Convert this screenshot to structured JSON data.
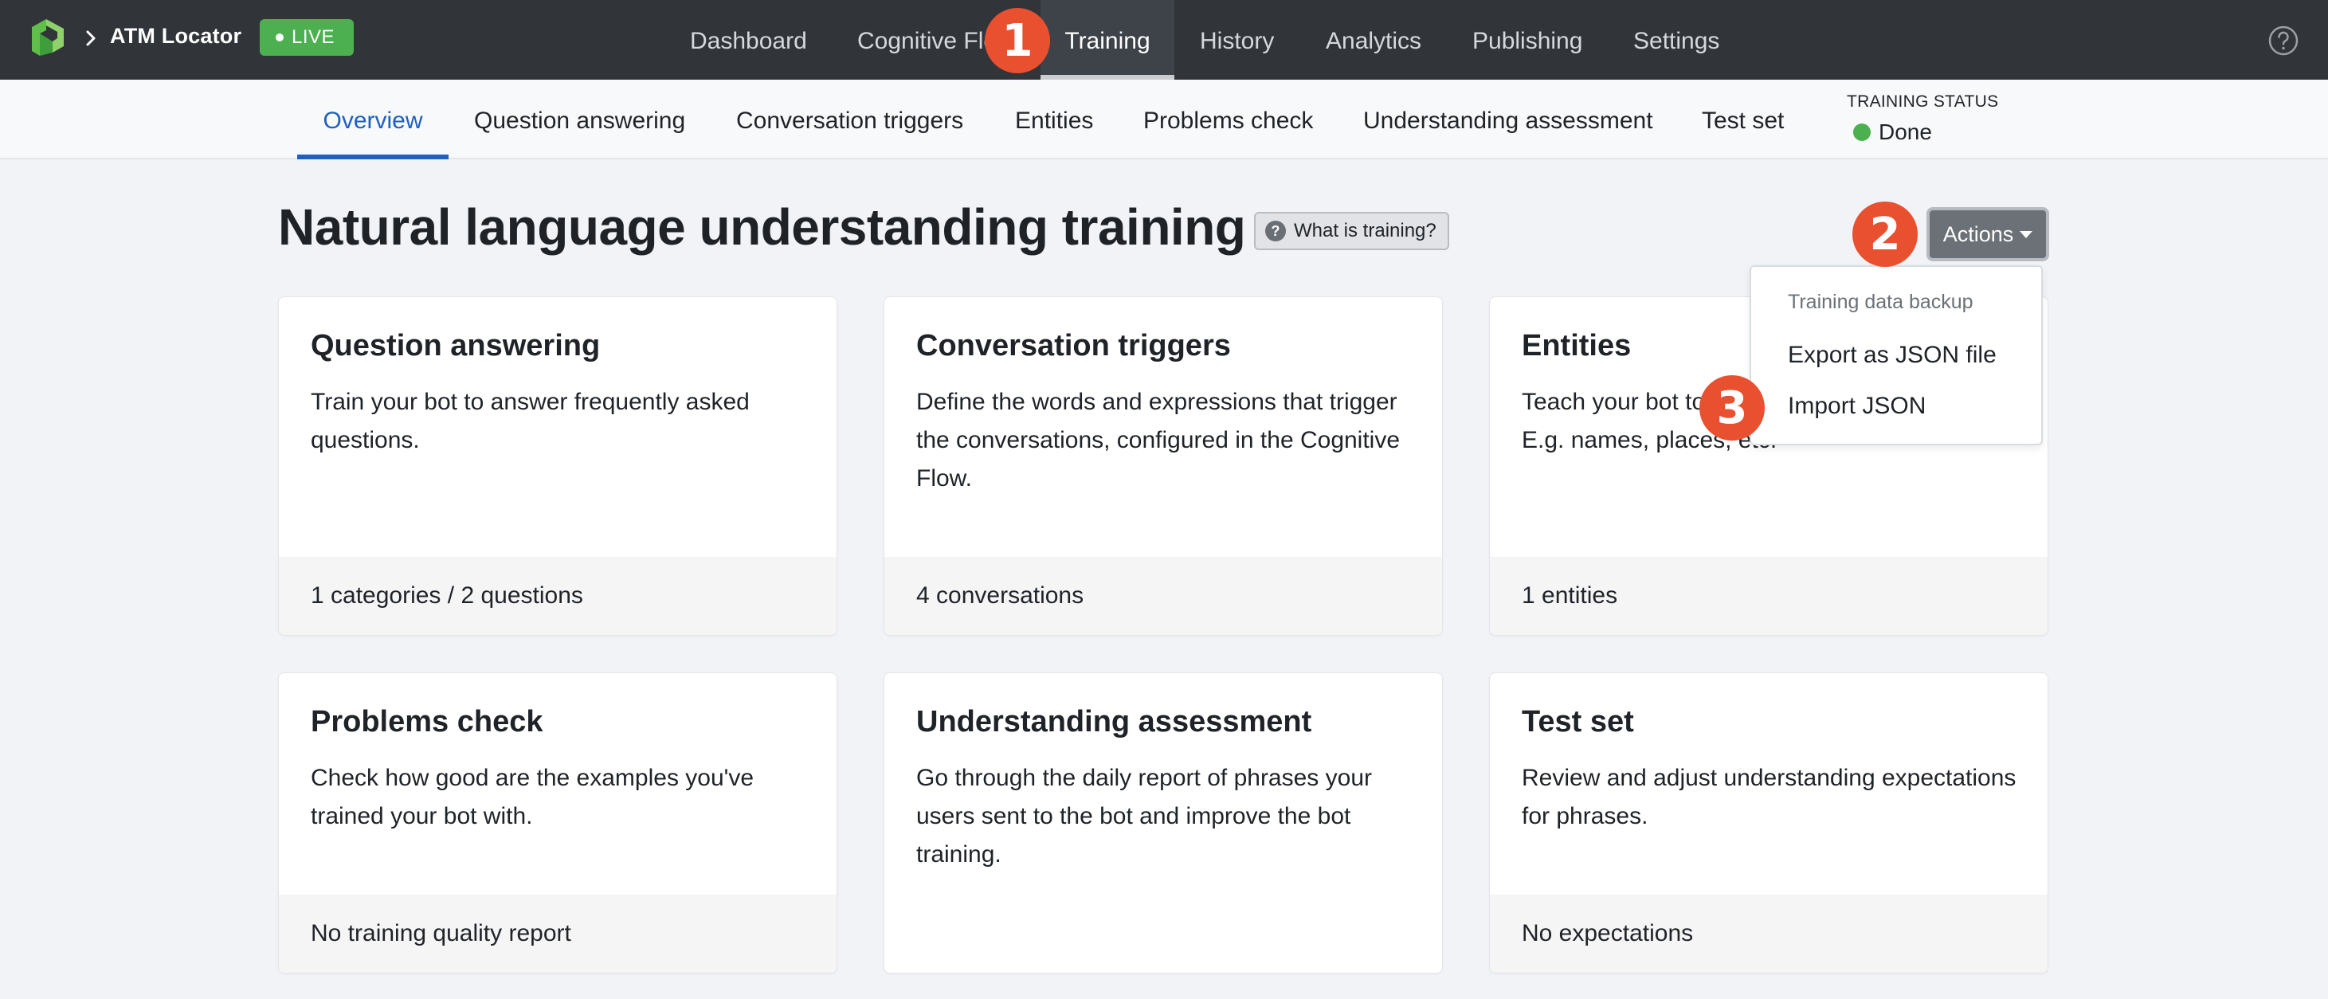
{
  "header": {
    "app_name": "ATM Locator",
    "live_label": "LIVE",
    "nav": [
      {
        "label": "Dashboard"
      },
      {
        "label": "Cognitive Flow"
      },
      {
        "label": "Training"
      },
      {
        "label": "History"
      },
      {
        "label": "Analytics"
      },
      {
        "label": "Publishing"
      },
      {
        "label": "Settings"
      }
    ],
    "active_nav": "Training",
    "help_icon": "question-circle-icon"
  },
  "subnav": {
    "items": [
      {
        "label": "Overview"
      },
      {
        "label": "Question answering"
      },
      {
        "label": "Conversation triggers"
      },
      {
        "label": "Entities"
      },
      {
        "label": "Problems check"
      },
      {
        "label": "Understanding assessment"
      },
      {
        "label": "Test set"
      }
    ],
    "active": "Overview",
    "training_status_label": "TRAINING STATUS",
    "training_status_value": "Done"
  },
  "page": {
    "title": "Natural language understanding training",
    "what_is_training": "What is training?",
    "what_icon_glyph": "?",
    "actions_label": "Actions"
  },
  "dropdown": {
    "header": "Training data backup",
    "items": [
      {
        "label": "Export as JSON file"
      },
      {
        "label": "Import JSON"
      }
    ]
  },
  "cards": [
    {
      "title": "Question answering",
      "description": "Train your bot to answer frequently asked questions.",
      "footer": "1 categories / 2 questions"
    },
    {
      "title": "Conversation triggers",
      "description": "Define the words and expressions that trigger the conversations, configured in the Cognitive Flow.",
      "footer": "4 conversations"
    },
    {
      "title": "Entities",
      "description": "Teach your bot to recognize things users say. E.g. names, places, etc.",
      "footer": "1 entities"
    },
    {
      "title": "Problems check",
      "description": "Check how good are the examples you've trained your bot with.",
      "footer": "No training quality report"
    },
    {
      "title": "Understanding assessment",
      "description": "Go through the daily report of phrases your users sent to the bot and improve the bot training.",
      "footer": ""
    },
    {
      "title": "Test set",
      "description": "Review and adjust understanding expectations for phrases.",
      "footer": "No expectations"
    }
  ],
  "steps": [
    "1",
    "2",
    "3"
  ],
  "colors": {
    "topbar": "#31353a",
    "live_green": "#4caf50",
    "active_blue": "#1f5fbf",
    "step_orange": "#e8502f",
    "actions_gray": "#6c7177"
  }
}
